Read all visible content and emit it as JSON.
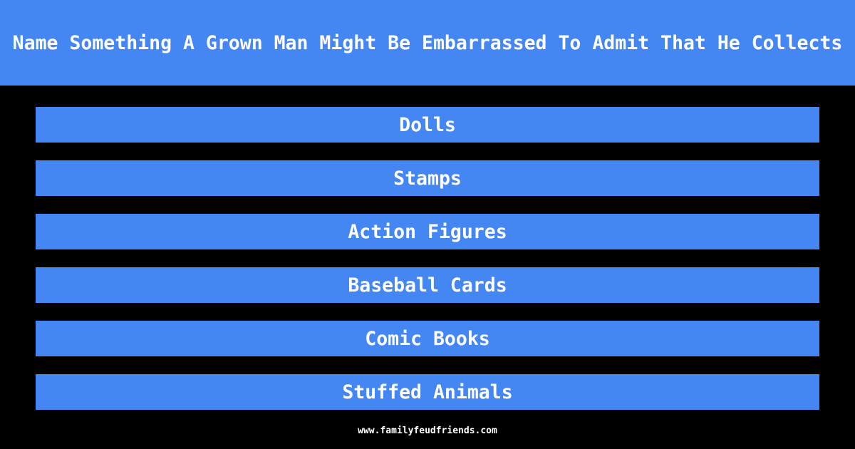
{
  "question": "Name Something A Grown Man Might Be Embarrassed To Admit That He Collects",
  "answers": [
    {
      "label": "Dolls"
    },
    {
      "label": "Stamps"
    },
    {
      "label": "Action Figures"
    },
    {
      "label": "Baseball Cards"
    },
    {
      "label": "Comic Books"
    },
    {
      "label": "Stuffed Animals"
    }
  ],
  "footer": {
    "url": "www.familyfeudfriends.com"
  },
  "colors": {
    "accent": "#4486f2",
    "background": "#000000",
    "text": "#ffffff"
  }
}
